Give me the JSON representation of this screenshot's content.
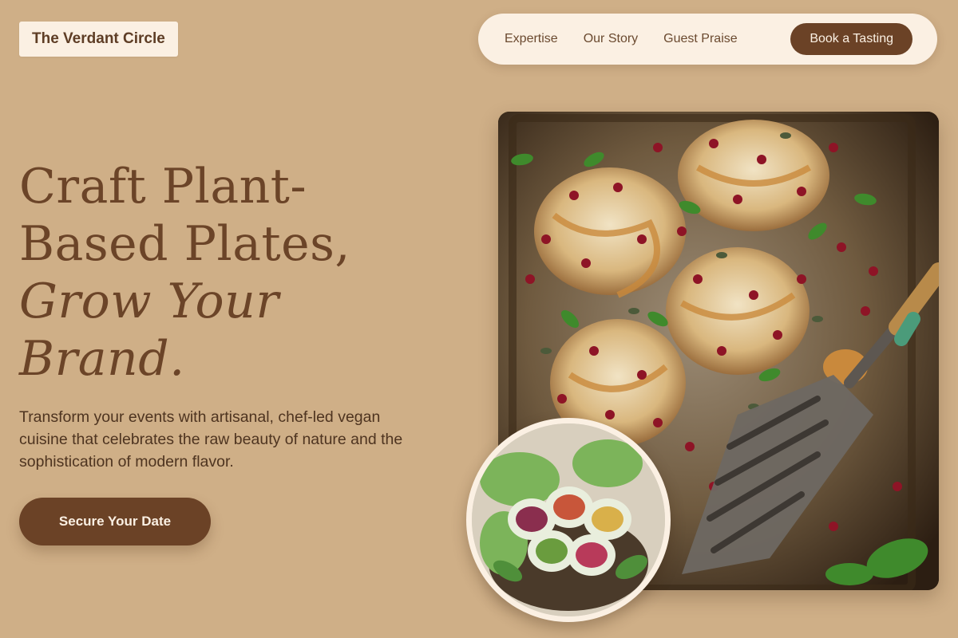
{
  "brand": {
    "name": "The Verdant Circle"
  },
  "nav": {
    "links": [
      "Expertise",
      "Our Story",
      "Guest Praise"
    ],
    "cta": "Book a Tasting"
  },
  "hero": {
    "headline_line1": "Craft Plant-",
    "headline_line2": "Based Plates,",
    "headline_line3": "Grow Your",
    "headline_line4": "Brand.",
    "subtext": "Transform your events with artisanal, chef-led vegan cuisine that celebrates the raw beauty of nature and the sophistication of modern flavor.",
    "cta": "Secure Your Date"
  },
  "images": {
    "main": "roasted-cauliflower-steaks-photo",
    "secondary": "fresh-spring-rolls-photo"
  },
  "colors": {
    "background": "#cfaf87",
    "cream": "#fbf0e3",
    "brand_brown": "#6b4226",
    "text": "#5a3a22"
  }
}
